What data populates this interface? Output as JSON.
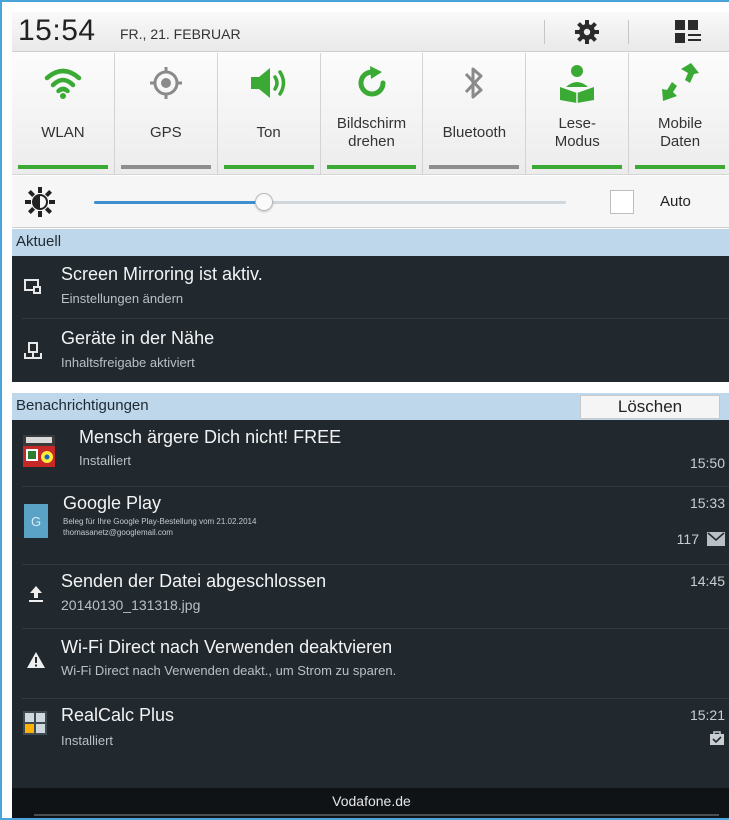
{
  "status_bar": {
    "time": "15:54",
    "date": "FR., 21. FEBRUAR",
    "icons": [
      "gear-icon",
      "quick-panel-grid-icon"
    ]
  },
  "quick_settings": [
    {
      "label": "WLAN",
      "icon": "wifi-icon",
      "active": true
    },
    {
      "label": "GPS",
      "icon": "gps-icon",
      "active": false
    },
    {
      "label": "Ton",
      "icon": "speaker-icon",
      "active": true
    },
    {
      "label": "Bildschirm\ndrehen",
      "icon": "rotate-icon",
      "active": true
    },
    {
      "label": "Bluetooth",
      "icon": "bluetooth-icon",
      "active": false
    },
    {
      "label": "Lese-\nModus",
      "icon": "reading-mode-icon",
      "active": true
    },
    {
      "label": "Mobile\nDaten",
      "icon": "mobile-data-icon",
      "active": true
    }
  ],
  "brightness": {
    "level": 0.36,
    "auto_label": "Auto",
    "auto_checked": false
  },
  "ongoing": {
    "header": "Aktuell",
    "items": [
      {
        "title": "Screen Mirroring ist aktiv.",
        "subtitle": "Einstellungen ändern",
        "icon": "screen-mirroring-icon"
      },
      {
        "title": "Geräte in der Nähe",
        "subtitle": "Inhaltsfreigabe aktiviert",
        "icon": "nearby-devices-icon"
      }
    ]
  },
  "notifications": {
    "header": "Benachrichtigungen",
    "clear_label": "Löschen",
    "items": [
      {
        "title": "Mensch ärgere Dich nicht! FREE",
        "subtitle": "Installiert",
        "time": "15:50",
        "icon": "game-app-icon"
      },
      {
        "title": "Google Play",
        "subtitle": "Beleg für Ihre Google Play-Bestellung vom 21.02.2014",
        "subtitle2": "thomasanetz@googlemail.com",
        "time": "15:33",
        "count": "117",
        "icon": "gmail-app-icon",
        "icon_letter": "G"
      },
      {
        "title": "Senden der Datei abgeschlossen",
        "subtitle": "20140130_131318.jpg",
        "time": "14:45",
        "icon": "upload-icon"
      },
      {
        "title": "Wi-Fi Direct nach Verwenden deaktvieren",
        "subtitle": "Wi-Fi Direct nach Verwenden deakt., um Strom zu sparen.",
        "time": "",
        "icon": "warning-icon"
      },
      {
        "title": "RealCalc Plus",
        "subtitle": "Installiert",
        "time": "15:21",
        "icon": "calculator-app-icon"
      }
    ]
  },
  "carrier": "Vodafone.de",
  "colors": {
    "accent_green": "#3aaa35",
    "section_header": "#bed7ea",
    "notification_bg": "#22292e",
    "slider_blue": "#3d8fd0"
  }
}
